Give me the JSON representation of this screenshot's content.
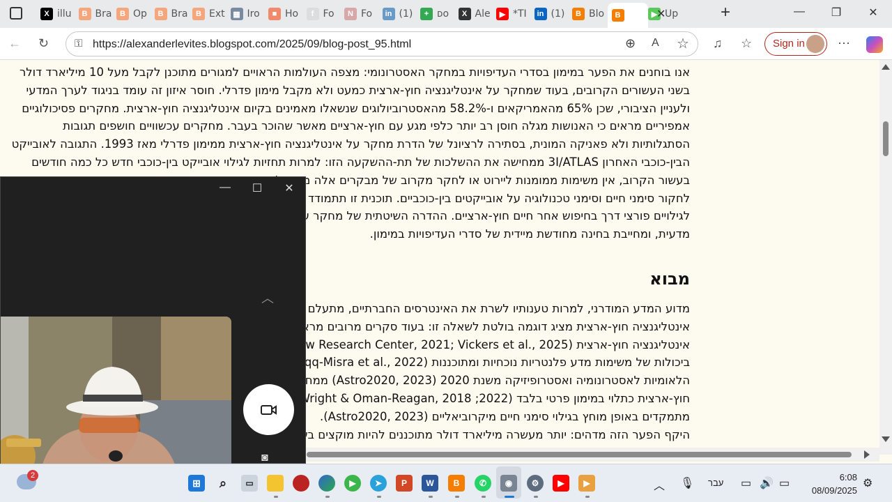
{
  "tabs": [
    {
      "label": "illu",
      "icon": "x-logo-icon",
      "color": "#000000"
    },
    {
      "label": "Bra",
      "icon": "blogger-icon",
      "color": "#f5a67c"
    },
    {
      "label": "Op",
      "icon": "blogger-icon",
      "color": "#f5a67c"
    },
    {
      "label": "Bra",
      "icon": "blogger-icon",
      "color": "#f5a67c"
    },
    {
      "label": "Ext",
      "icon": "blogger-icon",
      "color": "#f5a67c"
    },
    {
      "label": "Iro",
      "icon": "image-icon",
      "color": "#7a8aa0"
    },
    {
      "label": "Ho",
      "icon": "bookmark-icon",
      "color": "#f08a6a"
    },
    {
      "label": "Fo",
      "icon": "f-icon",
      "color": "#dddddd"
    },
    {
      "label": "Fo",
      "icon": "n-icon",
      "color": "#d8a8a8"
    },
    {
      "label": "(1)",
      "icon": "linkedin-icon",
      "color": "#6a9ac8"
    },
    {
      "label": "ᴅᴏ",
      "icon": "plus-green-icon",
      "color": "#34a853"
    },
    {
      "label": "Ale",
      "icon": "x-logo-icon",
      "color": "#333333"
    },
    {
      "label": "*TI",
      "icon": "youtube-icon",
      "color": "#ff0000"
    },
    {
      "label": "(1)",
      "icon": "linkedin-icon",
      "color": "#0a66c2"
    },
    {
      "label": "Blo",
      "icon": "blogger-icon",
      "color": "#f57d00"
    },
    {
      "label": "",
      "icon": "blogger-icon",
      "color": "#f57d00",
      "active": true
    },
    {
      "label": "Up",
      "icon": "play-icon",
      "color": "#5bc85b"
    }
  ],
  "address": {
    "url": "https://alexanderlevites.blogspot.com/2025/09/blog-post_95.html",
    "sign_in": "Sign in"
  },
  "article": {
    "para1": [
      "אנו בוחנים את הפער במימון בסדרי העדיפויות במחקר האסטרונומי: מצפה העולמות הראויים למגורים מתוכנן לקבל מעל 10 מיליארד דולר",
      "בשני העשורים הקרובים, בעוד שמחקר על אינטליגנציה חוץ-ארצית כמעט ולא מקבל מימון פדרלי. חוסר איזון זה עומד בניגוד לערך המדעי",
      "ולעניין הציבורי, שכן 65% מהאמריקאים ו-58.2% מהאסטרוביולוגים שנשאלו מאמינים בקיום אינטליגנציה חוץ-ארצית. מחקרים פסיכולוגיים",
      "אמפיריים מראים כי האנושות מגלה חוסן רב יותר כלפי מגע עם חוץ-ארציים מאשר שהוכר בעבר. מחקרים עכשוויים חושפים תגובות",
      "הסתגלותיות ולא פאניקה המונית, בסתירה לרציונל של הדרת מחקר על אינטליגנציה חוץ-ארצית ממימון פדרלי מאז 1993. התגובה לאובייקט",
      "הבין-כוכבי האחרון 3I/ATLAS ממחישה את ההשלכות של תת-ההשקעה הזו: למרות תחזיות לגילוי אובייקט בין-כוכבי חדש כל כמה חודשים",
      "בעשור הקרוב, אין משימות ממומנות ליירוט או לחקר מקרוב של מבקרים אלה מחוץ למערכת השמש. אנו טוענים שחשוב",
      "לחקור סימני חיים וסימני טכנולוגיה על אובייקטים בין-כוכביים. תוכנית זו תתמודד עם",
      "לגילויים פורצי דרך בחיפוש אחר חיים חוץ-ארציים. ההדרה השיטתית של מחקר על",
      "מדעית, ומחייבת בחינה מחודשת מיידית של סדרי העדיפויות במימון."
    ],
    "heading": "מבוא",
    "para2": [
      "מדוע המדע המודרני, למרות טענותיו לשרת את האינטרסים החברתיים, מתעלם מ",
      "אינטליגנציה חוץ-ארצית מציג דוגמה בולטת לשאלה זו: בעוד סקרים מרובים מראי",
      "אינטליגנציה חוץ-ארצית (Pew Research Center, 2021; Vickers et al., 2025",
      "ביכולות של משימות מדע פלנטריות נוכחיות ומתוכננות (Haqq-Misra et al., 2022",
      "הלאומיות לאסטרונומיה ואסטרופיזיקה משנת 2020 (Astro2020, 2023) ממחיש",
      "חוץ-ארצית כתלוי במימון פרטי בלבד (Wright & Oman-Reagan, 2018 ;2022",
      "מתמקדים באופן מוחץ בגילוי סימני חיים מיקרוביאליים (Astro2020, 2023).",
      "היקף הפער הזה מדהים: יותר מעשרה מיליארד דולר מתוכננים להיות מוקצים בש"
    ]
  },
  "taskbar": {
    "weather_badge": "2",
    "language": "עבר",
    "time": "6:08",
    "date": "08/09/2025"
  }
}
